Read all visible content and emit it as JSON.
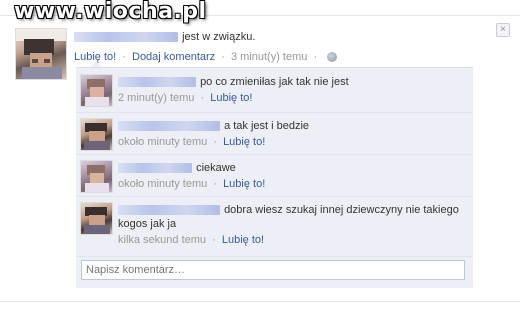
{
  "watermark": "www.wiocha.pl",
  "story": {
    "status_text": "jest w związku.",
    "like_link": "Lubię to!",
    "comment_link": "Dodaj komentarz",
    "time": "3 minut(y) temu",
    "separator": "·"
  },
  "comments": [
    {
      "text": "po co zmieniłas jak tak nie jest",
      "time": "2 minut(y) temu",
      "like": "Lubię to!"
    },
    {
      "text": "a tak jest i bedzie",
      "time": "około minuty temu",
      "like": "Lubię to!"
    },
    {
      "text": "ciekawe",
      "time": "około minuty temu",
      "like": "Lubię to!"
    },
    {
      "text": "dobra wiesz szukaj innej dziewczyny nie takiego kogos jak ja",
      "time": "kilka sekund temu",
      "like": "Lubię to!"
    }
  ],
  "comment_input": {
    "placeholder": "Napisz komentarz…",
    "value": ""
  },
  "icons": {
    "close": "close-icon",
    "privacy": "globe-icon"
  },
  "colors": {
    "link": "#3b5998",
    "meta": "#999999",
    "comment_bg": "#eceff5"
  }
}
